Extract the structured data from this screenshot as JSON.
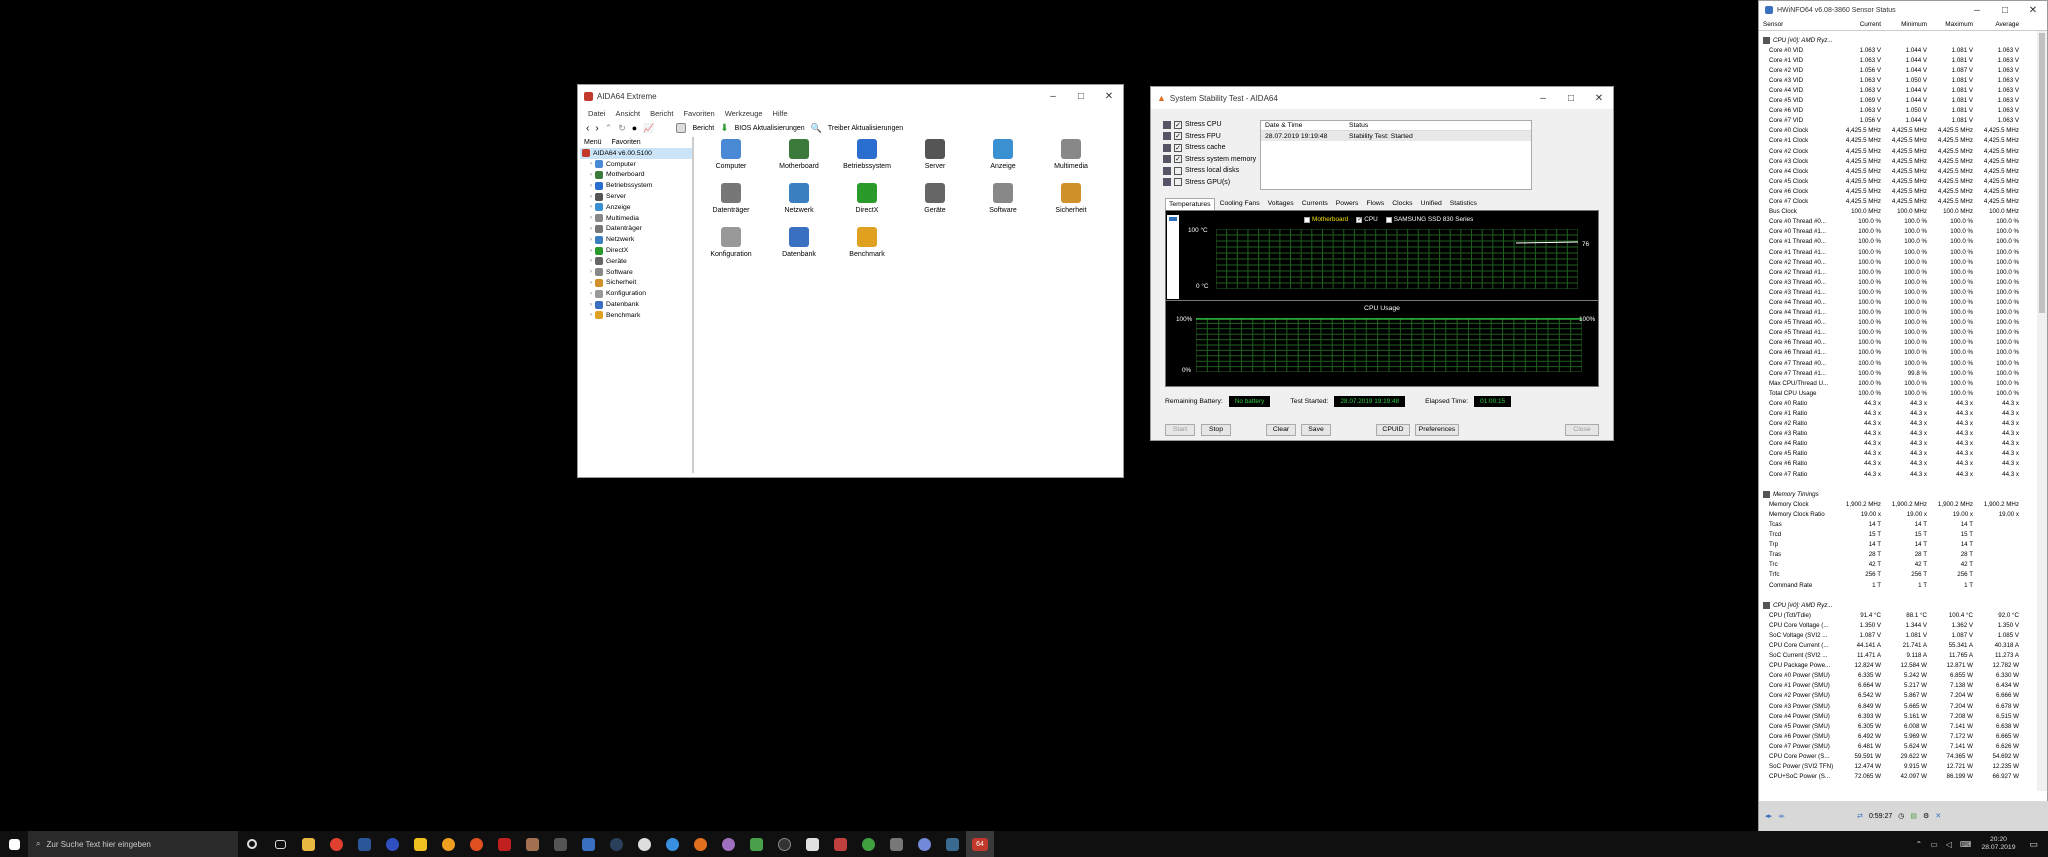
{
  "aida": {
    "title": "AIDA64 Extreme",
    "menu": [
      "Datei",
      "Ansicht",
      "Bericht",
      "Favoriten",
      "Werkzeuge",
      "Hilfe"
    ],
    "toolbar": {
      "report": "Bericht",
      "bios": "BIOS Aktualisierungen",
      "driver": "Treiber Aktualisierungen"
    },
    "panes": {
      "menu": "Menü",
      "fav": "Favoriten"
    },
    "root": "AIDA64 v6.00.5100",
    "tree": [
      {
        "label": "Computer",
        "color": "#4a8ad4"
      },
      {
        "label": "Motherboard",
        "color": "#3c7a3c"
      },
      {
        "label": "Betriebssystem",
        "color": "#2a6fd0"
      },
      {
        "label": "Server",
        "color": "#555"
      },
      {
        "label": "Anzeige",
        "color": "#3a90d0"
      },
      {
        "label": "Multimedia",
        "color": "#888"
      },
      {
        "label": "Datenträger",
        "color": "#777"
      },
      {
        "label": "Netzwerk",
        "color": "#3a80c0"
      },
      {
        "label": "DirectX",
        "color": "#2a9a2a"
      },
      {
        "label": "Geräte",
        "color": "#666"
      },
      {
        "label": "Software",
        "color": "#888"
      },
      {
        "label": "Sicherheit",
        "color": "#d0902a"
      },
      {
        "label": "Konfiguration",
        "color": "#999"
      },
      {
        "label": "Datenbank",
        "color": "#3a70c0"
      },
      {
        "label": "Benchmark",
        "color": "#e0a020"
      }
    ],
    "icons": [
      "Computer",
      "Motherboard",
      "Betriebssystem",
      "Server",
      "Anzeige",
      "Multimedia",
      "Datenträger",
      "Netzwerk",
      "DirectX",
      "Geräte",
      "Software",
      "Sicherheit",
      "Konfiguration",
      "Datenbank",
      "Benchmark"
    ]
  },
  "sst": {
    "title": "System Stability Test - AIDA64",
    "checks": [
      {
        "label": "Stress CPU",
        "on": true
      },
      {
        "label": "Stress FPU",
        "on": true
      },
      {
        "label": "Stress cache",
        "on": true
      },
      {
        "label": "Stress system memory",
        "on": true
      },
      {
        "label": "Stress local disks",
        "on": false
      },
      {
        "label": "Stress GPU(s)",
        "on": false
      }
    ],
    "log_headers": [
      "Date & Time",
      "Status"
    ],
    "log": [
      [
        "28.07.2019 19:19:48",
        "Stability Test: Started"
      ]
    ],
    "tabs": [
      "Temperatures",
      "Cooling Fans",
      "Voltages",
      "Currents",
      "Powers",
      "Flows",
      "Clocks",
      "Unified",
      "Statistics"
    ],
    "legend": [
      "Motherboard",
      "CPU",
      "SAMSUNG SSD 830 Series"
    ],
    "temp_top": "100 °C",
    "temp_bot": "0 °C",
    "temp_val": "76",
    "cpu_title": "CPU Usage",
    "cpu_top": "100%",
    "cpu_bot": "0%",
    "cpu_right": "100%",
    "batt_label": "Remaining Battery:",
    "batt_val": "No battery",
    "start_label": "Test Started:",
    "start_val": "28.07.2019 19:19:48",
    "elapsed_label": "Elapsed Time:",
    "elapsed_val": "01:00:15",
    "buttons": [
      "Start",
      "Stop",
      "Clear",
      "Save",
      "CPUID",
      "Preferences",
      "Close"
    ]
  },
  "hw": {
    "title": "HWiNFO64 v6.08-3860 Sensor Status",
    "headers": [
      "Sensor",
      "Current",
      "Minimum",
      "Maximum",
      "Average"
    ],
    "sec1": "CPU [#0]: AMD Ryz...",
    "rows1": [
      [
        "Core #0 VID",
        "1.063 V",
        "1.044 V",
        "1.081 V",
        "1.063 V"
      ],
      [
        "Core #1 VID",
        "1.063 V",
        "1.044 V",
        "1.081 V",
        "1.063 V"
      ],
      [
        "Core #2 VID",
        "1.056 V",
        "1.044 V",
        "1.087 V",
        "1.063 V"
      ],
      [
        "Core #3 VID",
        "1.063 V",
        "1.050 V",
        "1.081 V",
        "1.063 V"
      ],
      [
        "Core #4 VID",
        "1.063 V",
        "1.044 V",
        "1.081 V",
        "1.063 V"
      ],
      [
        "Core #5 VID",
        "1.069 V",
        "1.044 V",
        "1.081 V",
        "1.063 V"
      ],
      [
        "Core #6 VID",
        "1.063 V",
        "1.050 V",
        "1.081 V",
        "1.063 V"
      ],
      [
        "Core #7 VID",
        "1.056 V",
        "1.044 V",
        "1.081 V",
        "1.063 V"
      ],
      [
        "Core #0 Clock",
        "4,425.5 MHz",
        "4,425.5 MHz",
        "4,425.5 MHz",
        "4,425.5 MHz"
      ],
      [
        "Core #1 Clock",
        "4,425.5 MHz",
        "4,425.5 MHz",
        "4,425.5 MHz",
        "4,425.5 MHz"
      ],
      [
        "Core #2 Clock",
        "4,425.5 MHz",
        "4,425.5 MHz",
        "4,425.5 MHz",
        "4,425.5 MHz"
      ],
      [
        "Core #3 Clock",
        "4,425.5 MHz",
        "4,425.5 MHz",
        "4,425.5 MHz",
        "4,425.5 MHz"
      ],
      [
        "Core #4 Clock",
        "4,425.5 MHz",
        "4,425.5 MHz",
        "4,425.5 MHz",
        "4,425.5 MHz"
      ],
      [
        "Core #5 Clock",
        "4,425.5 MHz",
        "4,425.5 MHz",
        "4,425.5 MHz",
        "4,425.5 MHz"
      ],
      [
        "Core #6 Clock",
        "4,425.5 MHz",
        "4,425.5 MHz",
        "4,425.5 MHz",
        "4,425.5 MHz"
      ],
      [
        "Core #7 Clock",
        "4,425.5 MHz",
        "4,425.5 MHz",
        "4,425.5 MHz",
        "4,425.5 MHz"
      ],
      [
        "Bus Clock",
        "100.0 MHz",
        "100.0 MHz",
        "100.0 MHz",
        "100.0 MHz"
      ],
      [
        "Core #0 Thread #0...",
        "100.0 %",
        "100.0 %",
        "100.0 %",
        "100.0 %"
      ],
      [
        "Core #0 Thread #1...",
        "100.0 %",
        "100.0 %",
        "100.0 %",
        "100.0 %"
      ],
      [
        "Core #1 Thread #0...",
        "100.0 %",
        "100.0 %",
        "100.0 %",
        "100.0 %"
      ],
      [
        "Core #1 Thread #1...",
        "100.0 %",
        "100.0 %",
        "100.0 %",
        "100.0 %"
      ],
      [
        "Core #2 Thread #0...",
        "100.0 %",
        "100.0 %",
        "100.0 %",
        "100.0 %"
      ],
      [
        "Core #2 Thread #1...",
        "100.0 %",
        "100.0 %",
        "100.0 %",
        "100.0 %"
      ],
      [
        "Core #3 Thread #0...",
        "100.0 %",
        "100.0 %",
        "100.0 %",
        "100.0 %"
      ],
      [
        "Core #3 Thread #1...",
        "100.0 %",
        "100.0 %",
        "100.0 %",
        "100.0 %"
      ],
      [
        "Core #4 Thread #0...",
        "100.0 %",
        "100.0 %",
        "100.0 %",
        "100.0 %"
      ],
      [
        "Core #4 Thread #1...",
        "100.0 %",
        "100.0 %",
        "100.0 %",
        "100.0 %"
      ],
      [
        "Core #5 Thread #0...",
        "100.0 %",
        "100.0 %",
        "100.0 %",
        "100.0 %"
      ],
      [
        "Core #5 Thread #1...",
        "100.0 %",
        "100.0 %",
        "100.0 %",
        "100.0 %"
      ],
      [
        "Core #6 Thread #0...",
        "100.0 %",
        "100.0 %",
        "100.0 %",
        "100.0 %"
      ],
      [
        "Core #6 Thread #1...",
        "100.0 %",
        "100.0 %",
        "100.0 %",
        "100.0 %"
      ],
      [
        "Core #7 Thread #0...",
        "100.0 %",
        "100.0 %",
        "100.0 %",
        "100.0 %"
      ],
      [
        "Core #7 Thread #1...",
        "100.0 %",
        "99.8 %",
        "100.0 %",
        "100.0 %"
      ],
      [
        "Max CPU/Thread U...",
        "100.0 %",
        "100.0 %",
        "100.0 %",
        "100.0 %"
      ],
      [
        "Total CPU Usage",
        "100.0 %",
        "100.0 %",
        "100.0 %",
        "100.0 %"
      ],
      [
        "Core #0 Ratio",
        "44.3 x",
        "44.3 x",
        "44.3 x",
        "44.3 x"
      ],
      [
        "Core #1 Ratio",
        "44.3 x",
        "44.3 x",
        "44.3 x",
        "44.3 x"
      ],
      [
        "Core #2 Ratio",
        "44.3 x",
        "44.3 x",
        "44.3 x",
        "44.3 x"
      ],
      [
        "Core #3 Ratio",
        "44.3 x",
        "44.3 x",
        "44.3 x",
        "44.3 x"
      ],
      [
        "Core #4 Ratio",
        "44.3 x",
        "44.3 x",
        "44.3 x",
        "44.3 x"
      ],
      [
        "Core #5 Ratio",
        "44.3 x",
        "44.3 x",
        "44.3 x",
        "44.3 x"
      ],
      [
        "Core #6 Ratio",
        "44.3 x",
        "44.3 x",
        "44.3 x",
        "44.3 x"
      ],
      [
        "Core #7 Ratio",
        "44.3 x",
        "44.3 x",
        "44.3 x",
        "44.3 x"
      ]
    ],
    "sec2": "Memory Timings",
    "rows2": [
      [
        "Memory Clock",
        "1,900.2 MHz",
        "1,900.2 MHz",
        "1,900.2 MHz",
        "1,900.2 MHz"
      ],
      [
        "Memory Clock Ratio",
        "19.00 x",
        "19.00 x",
        "19.00 x",
        "19.00 x"
      ],
      [
        "Tcas",
        "14 T",
        "14 T",
        "14 T",
        ""
      ],
      [
        "Trcd",
        "15 T",
        "15 T",
        "15 T",
        ""
      ],
      [
        "Trp",
        "14 T",
        "14 T",
        "14 T",
        ""
      ],
      [
        "Tras",
        "28 T",
        "28 T",
        "28 T",
        ""
      ],
      [
        "Trc",
        "42 T",
        "42 T",
        "42 T",
        ""
      ],
      [
        "Trfc",
        "256 T",
        "256 T",
        "256 T",
        ""
      ],
      [
        "Command Rate",
        "1 T",
        "1 T",
        "1 T",
        ""
      ]
    ],
    "sec3": "CPU [#0]: AMD Ryz...",
    "rows3": [
      [
        "CPU (Tctl/Tdie)",
        "91.4 °C",
        "88.1 °C",
        "100.4 °C",
        "92.0 °C"
      ],
      [
        "CPU Core Voltage (...",
        "1.350 V",
        "1.344 V",
        "1.362 V",
        "1.350 V"
      ],
      [
        "SoC Voltage (SVI2 ...",
        "1.087 V",
        "1.081 V",
        "1.087 V",
        "1.085 V"
      ],
      [
        "CPU Core Current (...",
        "44.141 A",
        "21.741 A",
        "55.341 A",
        "40.318 A"
      ],
      [
        "SoC Current (SVI2 ...",
        "11.471 A",
        "9.118 A",
        "11.765 A",
        "11.273 A"
      ],
      [
        "CPU Package Powe...",
        "12.824 W",
        "12.584 W",
        "12.871 W",
        "12.782 W"
      ],
      [
        "Core #0 Power (SMU)",
        "6.335 W",
        "5.242 W",
        "6.855 W",
        "6.330 W"
      ],
      [
        "Core #1 Power (SMU)",
        "6.664 W",
        "5.217 W",
        "7.138 W",
        "6.434 W"
      ],
      [
        "Core #2 Power (SMU)",
        "6.542 W",
        "5.867 W",
        "7.204 W",
        "6.666 W"
      ],
      [
        "Core #3 Power (SMU)",
        "6.849 W",
        "5.665 W",
        "7.204 W",
        "6.678 W"
      ],
      [
        "Core #4 Power (SMU)",
        "6.393 W",
        "5.161 W",
        "7.208 W",
        "6.515 W"
      ],
      [
        "Core #5 Power (SMU)",
        "6.305 W",
        "6.008 W",
        "7.141 W",
        "6.638 W"
      ],
      [
        "Core #6 Power (SMU)",
        "6.492 W",
        "5.969 W",
        "7.172 W",
        "6.665 W"
      ],
      [
        "Core #7 Power (SMU)",
        "6.481 W",
        "5.624 W",
        "7.141 W",
        "6.626 W"
      ],
      [
        "CPU Core Power (S...",
        "59.591 W",
        "29.622 W",
        "74.365 W",
        "54.692 W"
      ],
      [
        "SoC Power (SVI2 TFN)",
        "12.474 W",
        "9.915 W",
        "12.721 W",
        "12.235 W"
      ],
      [
        "CPU+SoC Power (S...",
        "72.065 W",
        "42.097 W",
        "86.199 W",
        "66.927 W"
      ]
    ],
    "clock": "0:59:27"
  },
  "taskbar": {
    "search": "Zur Suche Text hier eingeben",
    "time": "20:20",
    "date": "28.07.2019",
    "app_badge": "64"
  }
}
